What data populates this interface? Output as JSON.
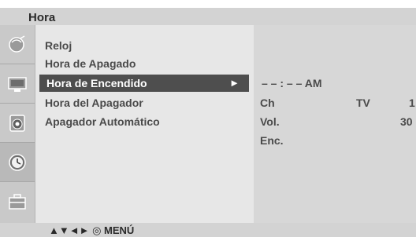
{
  "header": {
    "title": "Hora"
  },
  "sidebar": {
    "icons": [
      {
        "name": "satellite-dish-icon",
        "active": false
      },
      {
        "name": "tv-screen-icon",
        "active": false
      },
      {
        "name": "speaker-icon",
        "active": false
      },
      {
        "name": "clock-icon",
        "active": true
      },
      {
        "name": "toolbox-icon",
        "active": false
      }
    ]
  },
  "menu": {
    "items": [
      {
        "label": "Reloj"
      },
      {
        "label": "Hora de Apagado"
      },
      {
        "label": "Hora de Encendido",
        "selected": true,
        "arrow": "►"
      },
      {
        "label": "Hora del Apagador"
      },
      {
        "label": "Apagador Automático"
      }
    ]
  },
  "submenu": {
    "time": "– – : – –  AM",
    "rows": [
      {
        "label": "Ch",
        "value": "TV",
        "extra": "1"
      },
      {
        "label": "Vol.",
        "value": "",
        "extra": "30"
      },
      {
        "label": "Enc.",
        "value": "",
        "extra": ""
      }
    ]
  },
  "footer": {
    "nav_hint": "▲▼◄► ◎ MENÚ"
  },
  "colors": {
    "background": "#e7e7e7",
    "title_bar": "#d3d3d3",
    "selected_item": "#4e4e4e",
    "submenu_panel": "#d7d7d7"
  }
}
